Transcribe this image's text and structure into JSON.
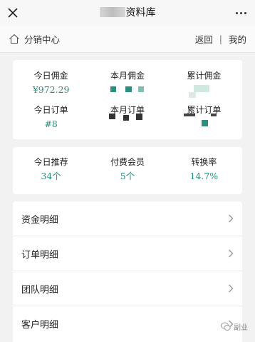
{
  "title_bar": {
    "title_visible": "资料库"
  },
  "nav": {
    "home_label": "分销中心",
    "back_label": "返回",
    "separator": "|",
    "mine_label": "我的"
  },
  "stats_top": {
    "row1": [
      {
        "label": "今日佣金",
        "value": "¥972.29"
      },
      {
        "label": "本月佣金",
        "value": ""
      },
      {
        "label": "累计佣金",
        "value": ""
      }
    ],
    "row2": [
      {
        "label": "今日订单",
        "value": "#8"
      },
      {
        "label": "本月订单",
        "value": ""
      },
      {
        "label": "累计订单",
        "value": ""
      }
    ]
  },
  "stats_bottom": [
    {
      "label": "今日推荐",
      "value": "34个"
    },
    {
      "label": "付费会员",
      "value": "5个"
    },
    {
      "label": "转换率",
      "value": "14.7%"
    }
  ],
  "menu": [
    {
      "label": "资金明细"
    },
    {
      "label": "订单明细"
    },
    {
      "label": "团队明细"
    },
    {
      "label": "客户明细"
    }
  ],
  "watermark": {
    "text": "副业"
  },
  "colors": {
    "accent": "#2a8f7c",
    "background": "#f2f2f2",
    "card": "#ffffff"
  }
}
